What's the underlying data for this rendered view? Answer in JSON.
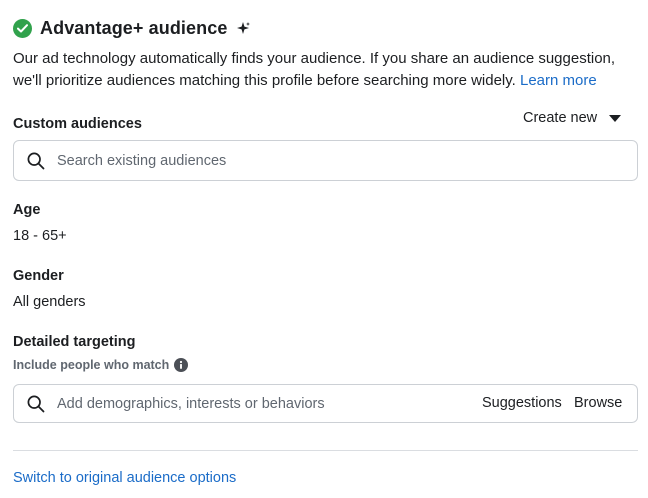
{
  "header": {
    "title": "Advantage+ audience",
    "status_icon": "check-circle-icon",
    "status_color": "#31a24c",
    "badge_icon": "sparkle-icon"
  },
  "description": {
    "text": "Our ad technology automatically finds your audience. If you share an audience suggestion, we'll prioritize audiences matching this profile before searching more widely.",
    "learn_more": "Learn more"
  },
  "custom_audiences": {
    "label": "Custom audiences",
    "create_new": "Create new",
    "search_placeholder": "Search existing audiences"
  },
  "age": {
    "label": "Age",
    "value": "18 - 65+"
  },
  "gender": {
    "label": "Gender",
    "value": "All genders"
  },
  "detailed_targeting": {
    "label": "Detailed targeting",
    "sublabel": "Include people who match",
    "search_placeholder": "Add demographics, interests or behaviors",
    "suggestions": "Suggestions",
    "browse": "Browse"
  },
  "footer": {
    "switch_link": "Switch to original audience options"
  },
  "colors": {
    "link": "#1b6cc8",
    "text": "#1c1e21",
    "muted": "#606770",
    "border": "#ccd0d5"
  }
}
